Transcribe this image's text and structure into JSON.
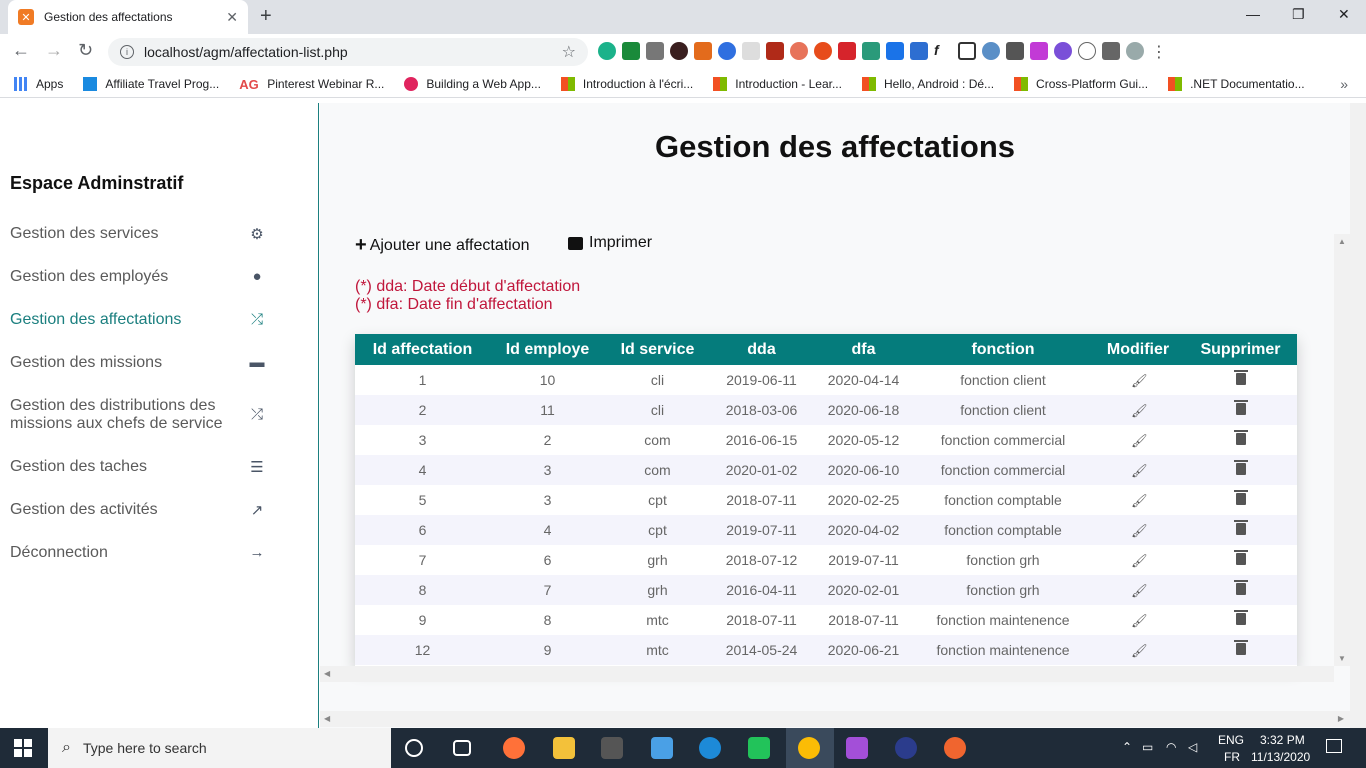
{
  "browser": {
    "tab_title": "Gestion des affectations",
    "url": "localhost/agm/affectation-list.php",
    "bookmarks": [
      {
        "label": "Apps"
      },
      {
        "label": "Affiliate Travel Prog..."
      },
      {
        "label": "Pinterest Webinar R..."
      },
      {
        "label": "Building a Web App..."
      },
      {
        "label": "Introduction à l'écri..."
      },
      {
        "label": "Introduction - Lear..."
      },
      {
        "label": "Hello, Android : Dé..."
      },
      {
        "label": "Cross-Platform Gui..."
      },
      {
        "label": ".NET Documentatio..."
      }
    ]
  },
  "sidebar": {
    "title": "Espace Adminstratif",
    "items": [
      {
        "label": "Gestion des services",
        "icon": "gears-icon"
      },
      {
        "label": "Gestion des employés",
        "icon": "user-icon"
      },
      {
        "label": "Gestion des affectations",
        "icon": "shuffle-icon",
        "active": true
      },
      {
        "label": "Gestion des missions",
        "icon": "briefcase-icon"
      },
      {
        "label": "Gestion des distributions des missions aux chefs de service",
        "icon": "shuffle-icon"
      },
      {
        "label": "Gestion des taches",
        "icon": "tasks-icon"
      },
      {
        "label": "Gestion des activités",
        "icon": "chart-line-icon"
      },
      {
        "label": "Déconnection",
        "icon": "arrow-right-icon"
      }
    ]
  },
  "main": {
    "title": "Gestion des affectations",
    "add_label": "Ajouter une affectation",
    "print_label": "Imprimer",
    "notes": [
      "(*) dda: Date début d'affectation",
      "(*) dfa: Date fin d'affectation"
    ],
    "table": {
      "headers": [
        "Id affectation",
        "Id employe",
        "Id service",
        "dda",
        "dfa",
        "fonction",
        "Modifier",
        "Supprimer"
      ],
      "rows": [
        [
          "1",
          "10",
          "cli",
          "2019-06-11",
          "2020-04-14",
          "fonction client"
        ],
        [
          "2",
          "11",
          "cli",
          "2018-03-06",
          "2020-06-18",
          "fonction client"
        ],
        [
          "3",
          "2",
          "com",
          "2016-06-15",
          "2020-05-12",
          "fonction commercial"
        ],
        [
          "4",
          "3",
          "com",
          "2020-01-02",
          "2020-06-10",
          "fonction commercial"
        ],
        [
          "5",
          "3",
          "cpt",
          "2018-07-11",
          "2020-02-25",
          "fonction comptable"
        ],
        [
          "6",
          "4",
          "cpt",
          "2019-07-11",
          "2020-04-02",
          "fonction comptable"
        ],
        [
          "7",
          "6",
          "grh",
          "2018-07-12",
          "2019-07-11",
          "fonction grh"
        ],
        [
          "8",
          "7",
          "grh",
          "2016-04-11",
          "2020-02-01",
          "fonction grh"
        ],
        [
          "9",
          "8",
          "mtc",
          "2018-07-11",
          "2018-07-11",
          "fonction maintenence"
        ],
        [
          "12",
          "9",
          "mtc",
          "2014-05-24",
          "2020-06-21",
          "fonction maintenence"
        ]
      ]
    }
  },
  "taskbar": {
    "search_placeholder": "Type here to search",
    "lang_top": "ENG",
    "lang_bottom": "FR",
    "time": "3:32 PM",
    "date": "11/13/2020"
  },
  "colors": {
    "accent": "#057c7c",
    "note": "#c0163b"
  }
}
